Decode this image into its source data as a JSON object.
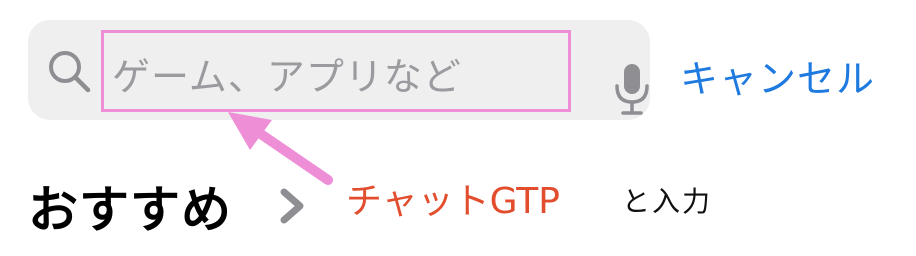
{
  "search": {
    "placeholder": "ゲーム、アプリなど",
    "cancel_label": "キャンセル"
  },
  "section": {
    "title": "おすすめ"
  },
  "annotation": {
    "input_text": "チャットGTP",
    "instruction": "と入力"
  },
  "icons": {
    "search": "search-icon",
    "microphone": "microphone-icon",
    "chevron": "chevron-right-icon",
    "arrow": "arrow-icon"
  },
  "colors": {
    "highlight": "#ee8ed6",
    "cancel": "#1f7ae0",
    "annotation_red": "#e14d2d",
    "search_bg": "#efeff0"
  }
}
